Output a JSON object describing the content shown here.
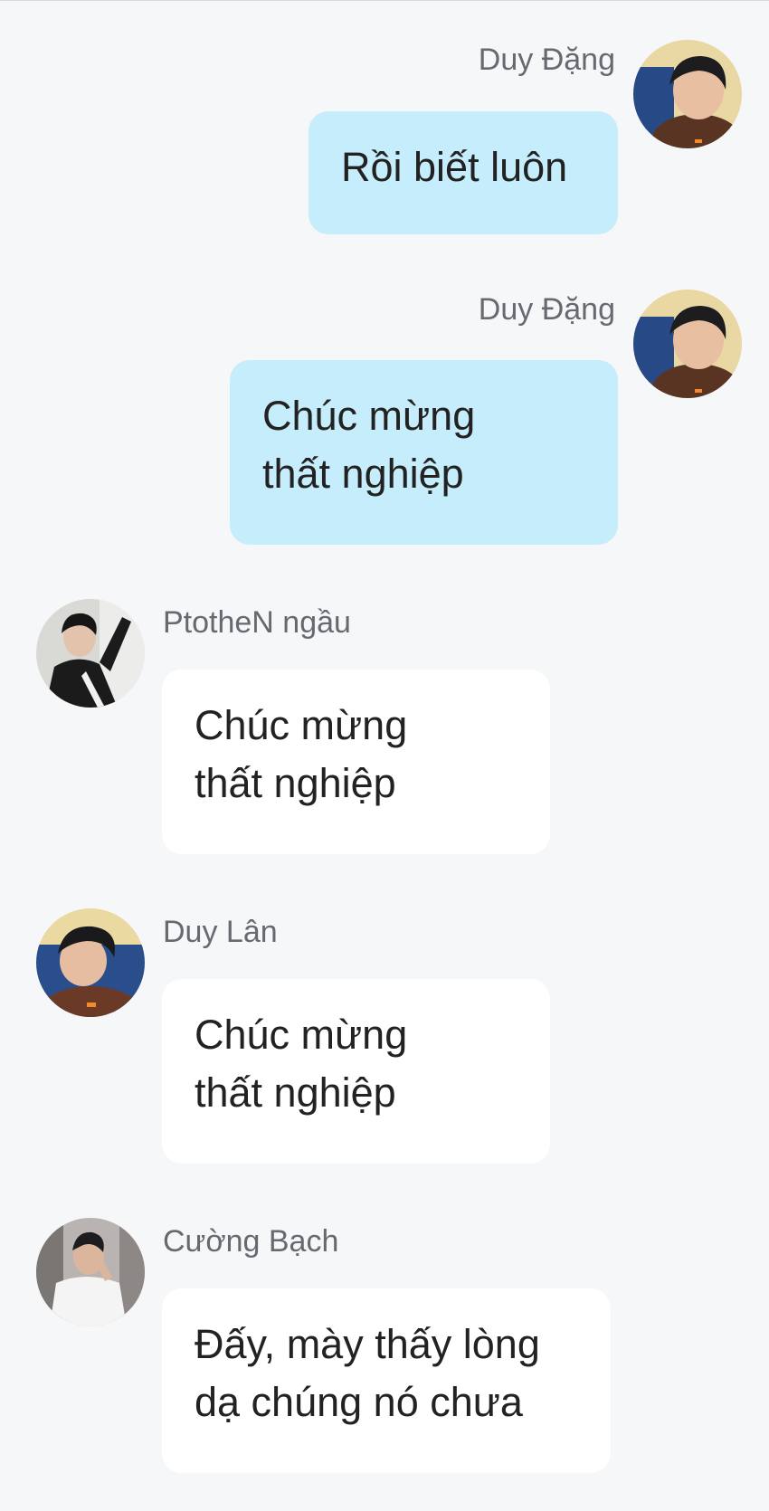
{
  "messages": [
    {
      "sender": "Duy Đặng",
      "text": "Rồi biết luôn",
      "avatar": "avatar-duy-dang",
      "side": "right"
    },
    {
      "sender": "Duy Đặng",
      "text": "Chúc mừng thất nghiệp",
      "avatar": "avatar-duy-dang",
      "side": "right"
    },
    {
      "sender": "PtotheN ngầu",
      "text": "Chúc mừng thất nghiệp",
      "avatar": "avatar-ptothen",
      "side": "left"
    },
    {
      "sender": "Duy Lân",
      "text": "Chúc mừng thất nghiệp",
      "avatar": "avatar-duy-lan",
      "side": "left"
    },
    {
      "sender": "Cường Bạch",
      "text": "Đấy, mày thấy lòng dạ chúng nó chưa",
      "avatar": "avatar-cuong-bach",
      "side": "left"
    }
  ],
  "colors": {
    "background": "#f6f7f9",
    "my_bubble": "#c6edfb",
    "their_bubble": "#ffffff",
    "sender_name": "#666a70",
    "message_text": "#222222"
  }
}
